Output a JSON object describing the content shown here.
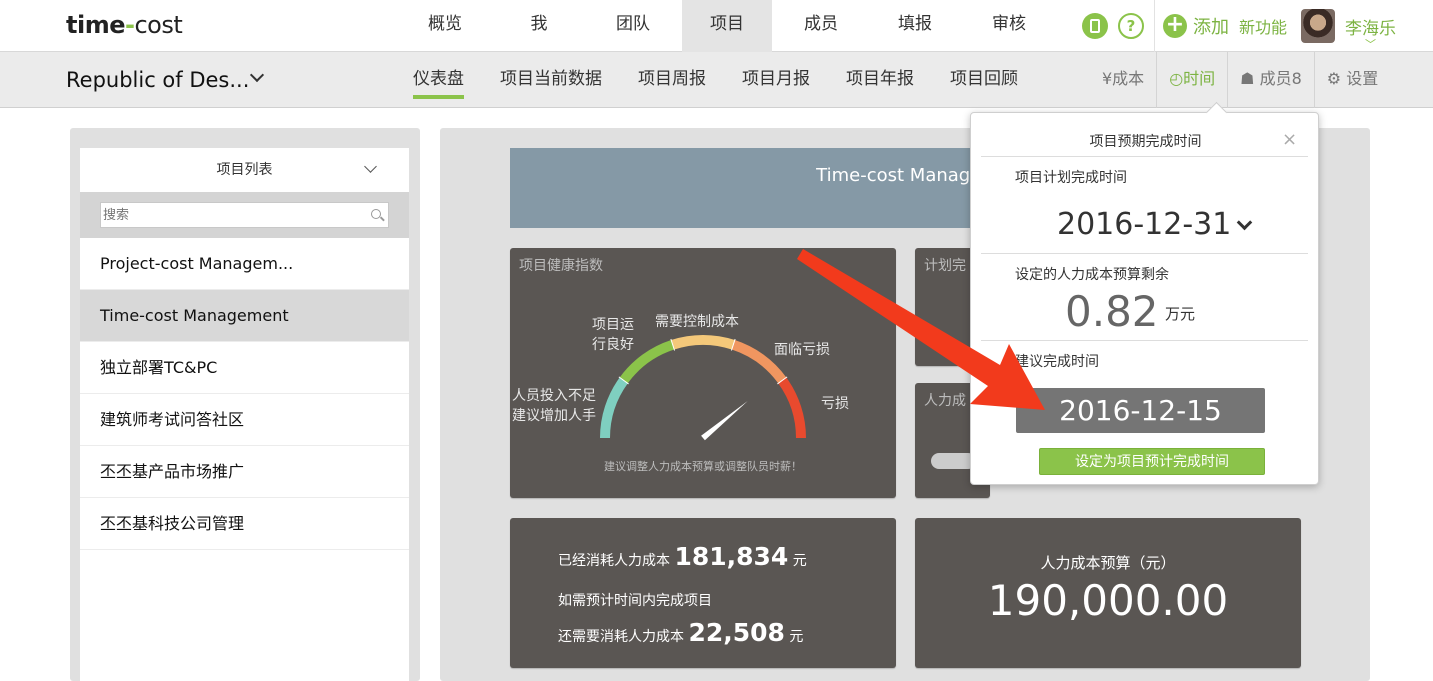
{
  "logo": {
    "part1": "time",
    "dash": "-",
    "part2": "cost"
  },
  "main_nav": [
    "概览",
    "我",
    "团队",
    "项目",
    "成员",
    "填报",
    "审核"
  ],
  "main_nav_active": 3,
  "top_right": {
    "add_label": "添加",
    "new_feature": "新功能",
    "username": "李海乐",
    "help": "?"
  },
  "project_selector": "Republic of Des...",
  "sub_nav": [
    "仪表盘",
    "项目当前数据",
    "项目周报",
    "项目月报",
    "项目年报",
    "项目回顾"
  ],
  "sub_right": {
    "cost": "¥成本",
    "time": "◴时间",
    "members": "成员8",
    "settings": "设置"
  },
  "project_list": {
    "header": "项目列表",
    "search_placeholder": "搜索",
    "items": [
      "Project-cost Managem...",
      "Time-cost Management",
      "独立部署TC&PC",
      "建筑师考试问答社区",
      "丕丕基产品市场推广",
      "丕丕基科技公司管理"
    ],
    "active_index": 1
  },
  "dashboard": {
    "banner": "Time-cost Managem",
    "health": {
      "title": "项目健康指数",
      "label_left_1": "人员投入不足",
      "label_left_2": "建议增加人手",
      "label_good_1": "项目运",
      "label_good_2": "行良好",
      "label_control": "需要控制成本",
      "label_loss_risk": "面临亏损",
      "label_loss": "亏损",
      "hint": "建议调整人力成本预算或调整队员时薪！",
      "needle_value": 0.78,
      "colors": [
        "#7fcfc0",
        "#8bc34a",
        "#f4c87a",
        "#f09660",
        "#e84a2e"
      ]
    },
    "plan_card_title": "计划完",
    "labor_card_title": "人力成",
    "consumed": {
      "prefix": "已经消耗人力成本",
      "value": "181,834",
      "unit": "元",
      "line2": "如需预计时间内完成项目",
      "prefix3": "还需要消耗人力成本",
      "value3": "22,508",
      "unit3": "元"
    },
    "budget": {
      "label": "人力成本预算（元）",
      "value": "190,000.00"
    }
  },
  "popup": {
    "title": "项目预期完成时间",
    "close": "×",
    "planned_label": "项目计划完成时间",
    "planned_date": "2016-12-31",
    "remaining_label": "设定的人力成本预算剩余",
    "remaining_value": "0.82",
    "remaining_unit": "万元",
    "suggest_label": "建议完成时间",
    "suggest_date": "2016-12-15",
    "set_button": "设定为项目预计完成时间"
  },
  "colors": {
    "accent": "#8bc34a",
    "arrow": "#f23a1c",
    "card": "#5a5653",
    "banner": "#8599a6"
  }
}
